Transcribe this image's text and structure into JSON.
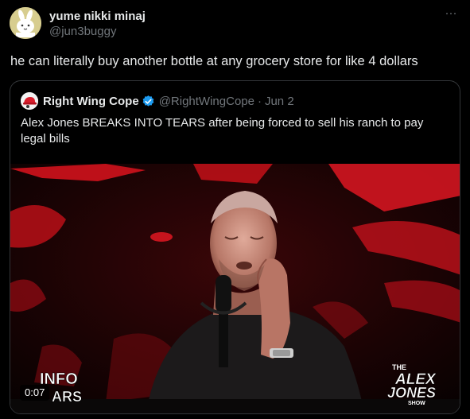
{
  "tweet": {
    "author_name": "yume nikki minaj",
    "author_handle": "@jun3buggy",
    "more_label": "···",
    "text": "he can literally buy another bottle at any grocery store for like 4 dollars"
  },
  "quoted": {
    "author_name": "Right Wing Cope",
    "author_handle": "@RightWingCope",
    "separator": "·",
    "date": "Jun 2",
    "text": "Alex Jones BREAKS INTO TEARS after being forced to sell his ranch to pay legal bills",
    "video": {
      "timestamp": "0:07",
      "logo_left": "INFOWARS",
      "logo_right_line1": "THE",
      "logo_right_line2": "ALEX",
      "logo_right_line3": "JONES",
      "logo_right_line4": "SHOW"
    }
  },
  "colors": {
    "background": "#000000",
    "text_primary": "#e7e9ea",
    "text_secondary": "#71767b",
    "border": "#333639",
    "verified": "#1d9bf0",
    "video_red": "#c0101a"
  },
  "icons": {
    "avatar": "white-rabbit-avatar",
    "quoted_avatar": "red-hat-avatar",
    "verified": "verified-badge-icon",
    "more": "more-horizontal-icon"
  }
}
